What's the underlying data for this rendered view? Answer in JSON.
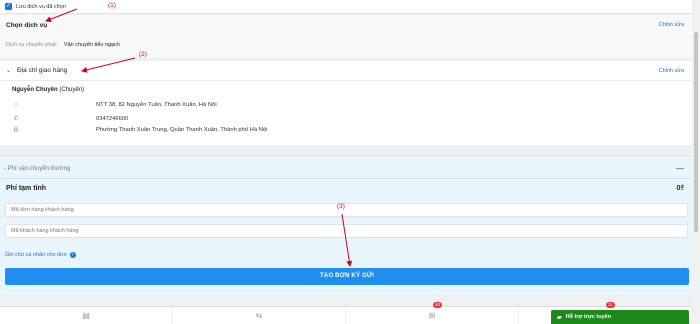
{
  "topbar": {
    "checkbox_label": "Lưu dịch vụ đã chọn"
  },
  "service": {
    "title": "Chọn dịch vụ",
    "edit": "Chỉnh sửa",
    "shipping_label": "Dịch vụ chuyển phát:",
    "shipping_value": "Vận chuyển tiểu ngạch"
  },
  "address": {
    "title": "Địa chỉ giao hàng",
    "edit": "Chỉnh sửa",
    "recipient_name": "Nguyễn Chuyên",
    "recipient_tag": "(Chuyên)",
    "street": "NTT 38, 82 Nguyễn Tuân, Thanh Xuân, Hà Nội",
    "phone": "0347246600",
    "ward": "Phường Thanh Xuân Trung, Quận Thanh Xuân, Thành phố Hà Nội"
  },
  "fee": {
    "section_title": "- Phí vận chuyển thường",
    "collapse": "—",
    "estimate_label": "Phí tạm tính",
    "estimate_value": "0₫",
    "order_code_placeholder": "Mã đơn hàng khách hàng",
    "customer_code_placeholder": "Mã khách hàng khách hàng",
    "note_link": "Ghi chú cá nhân cho đơn",
    "note_info": "?",
    "submit": "TẠO ĐƠN KÝ GỬI"
  },
  "bottombar": {
    "items": [
      {
        "icon": "document-icon",
        "glyph": "▤",
        "badge": ""
      },
      {
        "icon": "handshake-icon",
        "glyph": "◈",
        "badge": ""
      },
      {
        "icon": "cart-icon",
        "glyph": "🛒",
        "badge": "40"
      },
      {
        "icon": "cart-icon-2",
        "glyph": "",
        "badge": "11"
      }
    ]
  },
  "support": {
    "label": "Hỗ trợ trực tuyến"
  },
  "annotations": {
    "a1": "(1)",
    "a2": "(2)",
    "a3": "(3)"
  },
  "colors": {
    "accent": "#1e8ff0",
    "annotation": "#d0021b",
    "support": "#1b8a1b"
  }
}
